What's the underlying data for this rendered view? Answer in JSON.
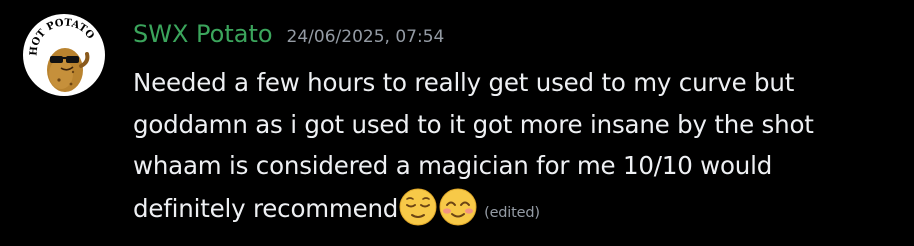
{
  "message": {
    "avatar": {
      "icon": "hot-potato-avatar-icon",
      "logo_text": "HOT POTATO"
    },
    "username": "SWX Potato",
    "username_color": "#3ba55c",
    "timestamp": "24/06/2025, 07:54",
    "text_lines": [
      "Needed a few hours to really get used to my curve but",
      "goddamn as i got used to it got more insane by the shot",
      "whaam is considered a magician for me 10/10 would",
      "definitely recommend"
    ],
    "emojis": [
      "relieved-face-emoji",
      "smiling-face-with-smiling-eyes-emoji"
    ],
    "edited_label": "(edited)"
  }
}
